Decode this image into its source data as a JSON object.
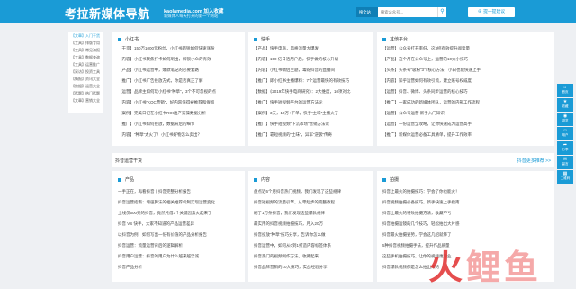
{
  "header": {
    "logo": "考拉新媒体导航",
    "site": "kaolamedia.com 加入收藏",
    "slogan": "新媒体人每天打开的第一个网站",
    "search_select": "搜全站",
    "search_placeholder": "搜索公众号...",
    "search_icon": "search-icon",
    "submit": "提一提建议"
  },
  "nav": [
    {
      "tag": "【文章】",
      "label": "入门干货"
    },
    {
      "tag": "【工具】",
      "label": "排版专用"
    },
    {
      "tag": "【工具】",
      "label": "常见海报"
    },
    {
      "tag": "【工具】",
      "label": "数据查询"
    },
    {
      "tag": "【工具】",
      "label": "运营推广"
    },
    {
      "tag": "【采访】",
      "label": "投资工具"
    },
    {
      "tag": "【情报】",
      "label": "资讯大全"
    },
    {
      "tag": "【数据】",
      "label": "运营大全"
    },
    {
      "tag": "【话题】",
      "label": "热门话题"
    },
    {
      "tag": "【文章】",
      "label": "营销大全"
    }
  ],
  "cards_top": [
    {
      "title": "小红书",
      "items": [
        "【干货】150万1000元粉丝，小红书新锐如何快速涨粉",
        "【内容】小红书聚焦打卡如何刷出，解锁小众的有效",
        "【产品】小红书运营中，爆款笔记的必要套路",
        "【推广】小红书广告投放方式，你是否真正了解",
        "【运营】品牌主如何玩小红书“种草”，3个不可忽视的点",
        "【内容】小红书“KOC营销”，好内容值得被推荐和保留",
        "【案例】完美日记在小红书ROI出产实操数据分析",
        "【推广】小红书如何投放，数据背后的细节",
        "【内容】“种草”太火了！小红书好物怎么卖出？"
      ]
    },
    {
      "title": "快手",
      "items": [
        "【产品】快手电商，风格流量大爆发",
        "【内容】150 亿日活用户后，快手做的核心升级",
        "【内容】小红书情侣主题，毒蛇抖音的直播间",
        "【推广】即小红书主播爆料：7个运营最快的有效技巧",
        "【数据】《2019年快手电商研究》：2大维度，10项对比",
        "【推广】快手短视频平台的运营方法论",
        "【案例】3天，10万+下单，快手“土味”主播火了",
        "【推广】快手短视频“下沉市场”营销方法论",
        "【推广】靠短视频的“土味”，异军“逆袭”传奇"
      ]
    },
    {
      "title": "其他平台",
      "items": [
        "【运营】公众号打开率低，这3招有效提升阅读量",
        "【产品】这个月在公众号上，运营的10大小技巧",
        "【头条】头条号“吸粉”3个核心方法，小白也能快速上手",
        "【内容】知乎运营如何有效引流，建立账号权威度",
        "【运营】抖音、微博、头条同步运营的核心技巧",
        "【推广】一家成功的新媒体团队，运营的内部工作流程",
        "【运营】公众号运营 新手入门知识",
        "【运营】一份运营全攻略，让你快速成为运营高手",
        "【推广】新媒体运营必备工具清单，提升工作效率"
      ]
    }
  ],
  "tab": {
    "title": "抖音运营干货",
    "more": "抖音更多推荐 >>"
  },
  "cards_bottom": [
    {
      "title": "产品",
      "items": [
        "一手正在，再看抖音丨抖音完整分析报告",
        "抖音运营指南：增强算法的相关推荐机制实现运营变化",
        "上线仅500天的抖音，竟然凭借3个关键因素火起来了",
        "抖音 VS 快手，大家不知道的产品运营差异",
        "以抖音为例，如何写出一份有价值的产品分析报告",
        "抖音运营：流量运营背后的逻辑解析",
        "抖音用户运营：抖音的用户为什么越来越忠诚",
        "抖音产品分析"
      ]
    },
    {
      "title": "内容",
      "items": [
        "盘点近6个月抖音热门视频，我们发现了这些规律",
        "抖音短视频的流量引擎，从零起步的完整教程",
        "刷了1万条抖音，我们发现这些爆款规律",
        "最实用的抖音视频拍摄技巧，月入20万",
        "抖音投放“种草”技巧分享，告诉你怎么做",
        "抖音运营中，如何从0到1打造内容标签体系",
        "抖音热门的视频制作方法，收藏起来",
        "抖音品牌营销的10大技巧，实战经验分享"
      ]
    },
    {
      "title": "拍摄",
      "items": [
        "抖音上最火的拍摄技巧：学会了你也能火！",
        "抖音视频拍摄必备技巧，新手快速上手指南",
        "抖音上最火的特效拍摄方法，收藏不亏",
        "抖音拍摄运镜的几个技巧，轻松拍出大片感",
        "抖音最火拍摄姿势，学会这几招就够了",
        "5种抖音视频拍摄手法，提升作品质量",
        "这些手机拍摄技巧，让你的视频更专业",
        "抖音爆款视频都是怎么拍出来的"
      ]
    }
  ],
  "side_buttons": [
    {
      "icon": "home-icon",
      "label": "首页"
    },
    {
      "icon": "star-icon",
      "label": "收藏"
    },
    {
      "icon": "eye-icon",
      "label": "浏览"
    },
    {
      "icon": "user-icon",
      "label": "用户"
    },
    {
      "icon": "share-icon",
      "label": "分享"
    },
    {
      "icon": "chat-icon",
      "label": "留言"
    },
    {
      "icon": "qr-icon",
      "label": "二维码"
    }
  ],
  "watermark": {
    "main": "火",
    "rest": "鲤鱼"
  },
  "colors": {
    "primary": "#1a9bd6",
    "watermark": "#e33b3b"
  }
}
